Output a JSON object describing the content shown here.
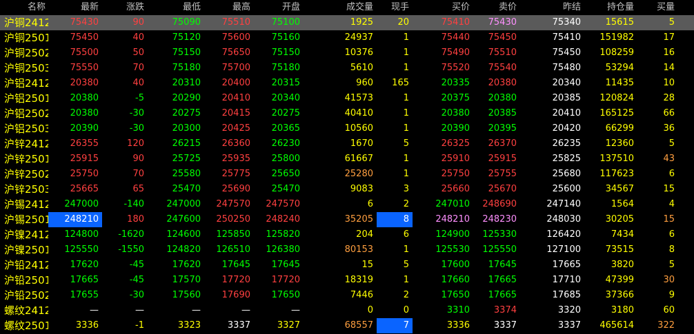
{
  "colors": {
    "up": "#ff4040",
    "down": "#00ff00",
    "flat": "#ffffff",
    "volume": "#ffff00",
    "volume_hot": "#ff9f3f",
    "name": "#ffff00",
    "highlight_row": "#5a5a5a",
    "selected_cell": "#0a64ff",
    "ask_pink": "#ff90ff",
    "background": "#000000"
  },
  "headers": {
    "name": "名称",
    "last": "最新",
    "change": "涨跌",
    "low": "最低",
    "high": "最高",
    "open": "开盘",
    "volume": "成交量",
    "current": "现手",
    "bid": "买价",
    "ask": "卖价",
    "prev_close": "昨结",
    "open_interest": "持仓量",
    "bid_vol": "买量",
    "ask_vol": "卖量"
  },
  "rows": [
    {
      "name": "沪铜2412",
      "last": "75430",
      "change": "90",
      "low": "75090",
      "high": "75510",
      "open": "75100",
      "volume": "1925",
      "current": "20",
      "bid": "75410",
      "ask": "75430",
      "prev_close": "75340",
      "open_interest": "15615",
      "bid_vol": "5",
      "ask_vol": "60",
      "c": {
        "last": "red",
        "change": "red",
        "low": "green",
        "high": "red",
        "open": "green",
        "volume": "yellow",
        "current": "yellow",
        "bid": "red",
        "ask": "pink",
        "prev_close": "white",
        "open_interest": "yellow",
        "bid_vol": "yellow",
        "ask_vol": "yellow"
      }
    },
    {
      "name": "沪铜2501",
      "last": "75450",
      "change": "40",
      "low": "75120",
      "high": "75600",
      "open": "75160",
      "volume": "24937",
      "current": "1",
      "bid": "75440",
      "ask": "75450",
      "prev_close": "75410",
      "open_interest": "151982",
      "bid_vol": "17",
      "ask_vol": "46",
      "c": {
        "last": "red",
        "change": "red",
        "low": "green",
        "high": "red",
        "open": "green",
        "volume": "yellow",
        "current": "yellow",
        "bid": "red",
        "ask": "red",
        "prev_close": "white",
        "open_interest": "yellow",
        "bid_vol": "yellow",
        "ask_vol": "yellow"
      }
    },
    {
      "name": "沪铜2502",
      "last": "75500",
      "change": "50",
      "low": "75150",
      "high": "75650",
      "open": "75150",
      "volume": "10376",
      "current": "1",
      "bid": "75490",
      "ask": "75510",
      "prev_close": "75450",
      "open_interest": "108259",
      "bid_vol": "16",
      "ask_vol": "10",
      "c": {
        "last": "red",
        "change": "red",
        "low": "green",
        "high": "red",
        "open": "green",
        "volume": "yellow",
        "current": "yellow",
        "bid": "red",
        "ask": "red",
        "prev_close": "white",
        "open_interest": "yellow",
        "bid_vol": "yellow",
        "ask_vol": "yellow"
      }
    },
    {
      "name": "沪铜2503",
      "last": "75550",
      "change": "70",
      "low": "75180",
      "high": "75700",
      "open": "75180",
      "volume": "5610",
      "current": "1",
      "bid": "75520",
      "ask": "75540",
      "prev_close": "75480",
      "open_interest": "53294",
      "bid_vol": "14",
      "ask_vol": "4",
      "c": {
        "last": "red",
        "change": "red",
        "low": "green",
        "high": "red",
        "open": "green",
        "volume": "yellow",
        "current": "yellow",
        "bid": "red",
        "ask": "red",
        "prev_close": "white",
        "open_interest": "yellow",
        "bid_vol": "yellow",
        "ask_vol": "yellow"
      }
    },
    {
      "name": "沪铝2412",
      "last": "20380",
      "change": "40",
      "low": "20310",
      "high": "20400",
      "open": "20315",
      "volume": "960",
      "current": "165",
      "bid": "20335",
      "ask": "20380",
      "prev_close": "20340",
      "open_interest": "11435",
      "bid_vol": "10",
      "ask_vol": "15",
      "c": {
        "last": "red",
        "change": "red",
        "low": "green",
        "high": "red",
        "open": "green",
        "volume": "yellow",
        "current": "yellow",
        "bid": "green",
        "ask": "red",
        "prev_close": "white",
        "open_interest": "yellow",
        "bid_vol": "yellow",
        "ask_vol": "yellow"
      }
    },
    {
      "name": "沪铝2501",
      "last": "20380",
      "change": "-5",
      "low": "20290",
      "high": "20410",
      "open": "20340",
      "volume": "41573",
      "current": "1",
      "bid": "20375",
      "ask": "20380",
      "prev_close": "20385",
      "open_interest": "120824",
      "bid_vol": "28",
      "ask_vol": "36",
      "c": {
        "last": "green",
        "change": "green",
        "low": "green",
        "high": "red",
        "open": "green",
        "volume": "yellow",
        "current": "yellow",
        "bid": "green",
        "ask": "green",
        "prev_close": "white",
        "open_interest": "yellow",
        "bid_vol": "yellow",
        "ask_vol": "yellow"
      }
    },
    {
      "name": "沪铝2502",
      "last": "20380",
      "change": "-30",
      "low": "20275",
      "high": "20415",
      "open": "20275",
      "volume": "40410",
      "current": "1",
      "bid": "20380",
      "ask": "20385",
      "prev_close": "20410",
      "open_interest": "165125",
      "bid_vol": "66",
      "ask_vol": "64",
      "c": {
        "last": "green",
        "change": "green",
        "low": "green",
        "high": "red",
        "open": "green",
        "volume": "yellow",
        "current": "yellow",
        "bid": "green",
        "ask": "green",
        "prev_close": "white",
        "open_interest": "yellow",
        "bid_vol": "yellow",
        "ask_vol": "yellow"
      }
    },
    {
      "name": "沪铝2503",
      "last": "20390",
      "change": "-30",
      "low": "20300",
      "high": "20425",
      "open": "20365",
      "volume": "10560",
      "current": "1",
      "bid": "20390",
      "ask": "20395",
      "prev_close": "20420",
      "open_interest": "66299",
      "bid_vol": "36",
      "ask_vol": "2",
      "c": {
        "last": "green",
        "change": "green",
        "low": "green",
        "high": "red",
        "open": "green",
        "volume": "yellow",
        "current": "yellow",
        "bid": "green",
        "ask": "green",
        "prev_close": "white",
        "open_interest": "yellow",
        "bid_vol": "yellow",
        "ask_vol": "yellow"
      }
    },
    {
      "name": "沪锌2412",
      "last": "26355",
      "change": "120",
      "low": "26215",
      "high": "26360",
      "open": "26230",
      "volume": "1670",
      "current": "5",
      "bid": "26325",
      "ask": "26370",
      "prev_close": "26235",
      "open_interest": "12360",
      "bid_vol": "5",
      "ask_vol": "5",
      "c": {
        "last": "red",
        "change": "red",
        "low": "green",
        "high": "red",
        "open": "green",
        "volume": "yellow",
        "current": "yellow",
        "bid": "red",
        "ask": "red",
        "prev_close": "white",
        "open_interest": "yellow",
        "bid_vol": "yellow",
        "ask_vol": "yellow"
      }
    },
    {
      "name": "沪锌2501",
      "last": "25915",
      "change": "90",
      "low": "25725",
      "high": "25935",
      "open": "25800",
      "volume": "61667",
      "current": "1",
      "bid": "25910",
      "ask": "25915",
      "prev_close": "25825",
      "open_interest": "137510",
      "bid_vol": "43",
      "ask_vol": "10",
      "c": {
        "last": "red",
        "change": "red",
        "low": "green",
        "high": "red",
        "open": "green",
        "volume": "yellow",
        "current": "yellow",
        "bid": "red",
        "ask": "red",
        "prev_close": "white",
        "open_interest": "yellow",
        "bid_vol": "orange",
        "ask_vol": "yellow"
      }
    },
    {
      "name": "沪锌2502",
      "last": "25750",
      "change": "70",
      "low": "25580",
      "high": "25775",
      "open": "25650",
      "volume": "25280",
      "current": "1",
      "bid": "25750",
      "ask": "25755",
      "prev_close": "25680",
      "open_interest": "117623",
      "bid_vol": "6",
      "ask_vol": "30",
      "c": {
        "last": "red",
        "change": "red",
        "low": "green",
        "high": "red",
        "open": "green",
        "volume": "orange",
        "current": "yellow",
        "bid": "red",
        "ask": "red",
        "prev_close": "white",
        "open_interest": "yellow",
        "bid_vol": "yellow",
        "ask_vol": "yellow"
      }
    },
    {
      "name": "沪锌2503",
      "last": "25665",
      "change": "65",
      "low": "25470",
      "high": "25690",
      "open": "25470",
      "volume": "9083",
      "current": "3",
      "bid": "25660",
      "ask": "25670",
      "prev_close": "25600",
      "open_interest": "34567",
      "bid_vol": "15",
      "ask_vol": "7",
      "c": {
        "last": "red",
        "change": "red",
        "low": "green",
        "high": "red",
        "open": "green",
        "volume": "yellow",
        "current": "yellow",
        "bid": "red",
        "ask": "red",
        "prev_close": "white",
        "open_interest": "yellow",
        "bid_vol": "yellow",
        "ask_vol": "yellow"
      }
    },
    {
      "name": "沪锡2412",
      "last": "247000",
      "change": "-140",
      "low": "247000",
      "high": "247570",
      "open": "247570",
      "volume": "6",
      "current": "2",
      "bid": "247010",
      "ask": "248690",
      "prev_close": "247140",
      "open_interest": "1564",
      "bid_vol": "4",
      "ask_vol": "2",
      "c": {
        "last": "green",
        "change": "green",
        "low": "green",
        "high": "red",
        "open": "red",
        "volume": "yellow",
        "current": "yellow",
        "bid": "green",
        "ask": "red",
        "prev_close": "white",
        "open_interest": "yellow",
        "bid_vol": "yellow",
        "ask_vol": "yellow"
      }
    },
    {
      "name": "沪锡2501",
      "last": "248210",
      "change": "180",
      "low": "247600",
      "high": "250250",
      "open": "248240",
      "volume": "35205",
      "current": "8",
      "bid": "248210",
      "ask": "248230",
      "prev_close": "248030",
      "open_interest": "30205",
      "bid_vol": "15",
      "ask_vol": "6",
      "boxed": [
        "last",
        "current"
      ],
      "c": {
        "last": "white",
        "change": "red",
        "low": "green",
        "high": "red",
        "open": "red",
        "volume": "orange",
        "current": "white",
        "bid": "pink",
        "ask": "pink",
        "prev_close": "white",
        "open_interest": "yellow",
        "bid_vol": "orange",
        "ask_vol": "yellow"
      }
    },
    {
      "name": "沪镍2412",
      "last": "124800",
      "change": "-1620",
      "low": "124600",
      "high": "125850",
      "open": "125820",
      "volume": "204",
      "current": "6",
      "bid": "124900",
      "ask": "125330",
      "prev_close": "126420",
      "open_interest": "7434",
      "bid_vol": "6",
      "ask_vol": "6",
      "c": {
        "last": "green",
        "change": "green",
        "low": "green",
        "high": "green",
        "open": "green",
        "volume": "yellow",
        "current": "yellow",
        "bid": "green",
        "ask": "green",
        "prev_close": "white",
        "open_interest": "yellow",
        "bid_vol": "yellow",
        "ask_vol": "yellow"
      }
    },
    {
      "name": "沪镍2501",
      "last": "125550",
      "change": "-1550",
      "low": "124820",
      "high": "126510",
      "open": "126380",
      "volume": "80153",
      "current": "1",
      "bid": "125530",
      "ask": "125550",
      "prev_close": "127100",
      "open_interest": "73515",
      "bid_vol": "8",
      "ask_vol": "3",
      "c": {
        "last": "green",
        "change": "green",
        "low": "green",
        "high": "green",
        "open": "green",
        "volume": "orange",
        "current": "yellow",
        "bid": "green",
        "ask": "green",
        "prev_close": "white",
        "open_interest": "yellow",
        "bid_vol": "yellow",
        "ask_vol": "yellow"
      }
    },
    {
      "name": "沪铅2412",
      "last": "17620",
      "change": "-45",
      "low": "17620",
      "high": "17645",
      "open": "17645",
      "volume": "15",
      "current": "5",
      "bid": "17600",
      "ask": "17645",
      "prev_close": "17665",
      "open_interest": "3820",
      "bid_vol": "5",
      "ask_vol": "5",
      "c": {
        "last": "green",
        "change": "green",
        "low": "green",
        "high": "green",
        "open": "green",
        "volume": "yellow",
        "current": "yellow",
        "bid": "green",
        "ask": "green",
        "prev_close": "white",
        "open_interest": "yellow",
        "bid_vol": "yellow",
        "ask_vol": "yellow"
      }
    },
    {
      "name": "沪铅2501",
      "last": "17665",
      "change": "-45",
      "low": "17570",
      "high": "17720",
      "open": "17720",
      "volume": "18319",
      "current": "1",
      "bid": "17660",
      "ask": "17665",
      "prev_close": "17710",
      "open_interest": "47399",
      "bid_vol": "30",
      "ask_vol": "17",
      "c": {
        "last": "green",
        "change": "green",
        "low": "green",
        "high": "red",
        "open": "red",
        "volume": "yellow",
        "current": "yellow",
        "bid": "green",
        "ask": "green",
        "prev_close": "white",
        "open_interest": "yellow",
        "bid_vol": "orange",
        "ask_vol": "yellow"
      }
    },
    {
      "name": "沪铅2502",
      "last": "17655",
      "change": "-30",
      "low": "17560",
      "high": "17690",
      "open": "17650",
      "volume": "7446",
      "current": "2",
      "bid": "17650",
      "ask": "17665",
      "prev_close": "17685",
      "open_interest": "37366",
      "bid_vol": "9",
      "ask_vol": "1",
      "c": {
        "last": "green",
        "change": "green",
        "low": "green",
        "high": "red",
        "open": "green",
        "volume": "yellow",
        "current": "yellow",
        "bid": "green",
        "ask": "green",
        "prev_close": "white",
        "open_interest": "yellow",
        "bid_vol": "yellow",
        "ask_vol": "yellow"
      }
    },
    {
      "name": "螺纹2412",
      "last": "—",
      "change": "—",
      "low": "—",
      "high": "—",
      "open": "—",
      "volume": "0",
      "current": "0",
      "bid": "3310",
      "ask": "3374",
      "prev_close": "3320",
      "open_interest": "3180",
      "bid_vol": "60",
      "ask_vol": "30",
      "c": {
        "last": "white",
        "change": "white",
        "low": "white",
        "high": "white",
        "open": "white",
        "volume": "yellow",
        "current": "yellow",
        "bid": "green",
        "ask": "red",
        "prev_close": "white",
        "open_interest": "yellow",
        "bid_vol": "yellow",
        "ask_vol": "yellow"
      }
    },
    {
      "name": "螺纹2501",
      "last": "3336",
      "change": "-1",
      "low": "3323",
      "high": "3337",
      "open": "3327",
      "volume": "68557",
      "current": "7",
      "bid": "3336",
      "ask": "3337",
      "prev_close": "3337",
      "open_interest": "465614",
      "bid_vol": "322",
      "ask_vol": "415",
      "boxed": [
        "current"
      ],
      "c": {
        "last": "yellow",
        "change": "yellow",
        "low": "yellow",
        "high": "white",
        "open": "yellow",
        "volume": "orange",
        "current": "white",
        "bid": "yellow",
        "ask": "white",
        "prev_close": "white",
        "open_interest": "yellow",
        "bid_vol": "orange",
        "ask_vol": "yellow"
      }
    }
  ]
}
